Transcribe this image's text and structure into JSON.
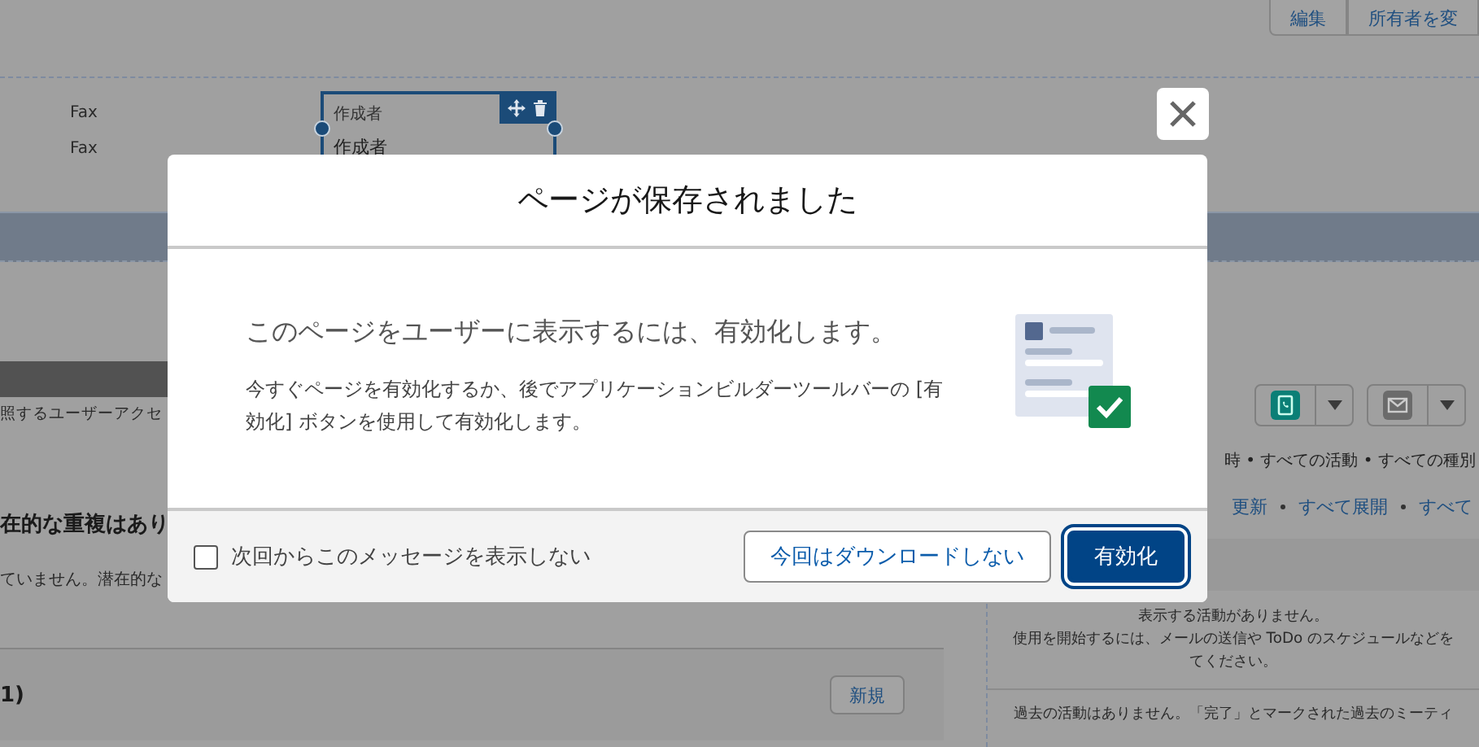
{
  "page": {
    "header_buttons": [
      "編集",
      "所有者を変"
    ],
    "fields": [
      "Fax",
      "Fax"
    ],
    "selected_component": {
      "labels": [
        "作成者",
        "作成者"
      ]
    },
    "left": {
      "access_text": "照するユーザーアクセ",
      "duplicates_title": "在的な重複はあり",
      "duplicates_text": "ていません。潜在的な",
      "related_title": "1)",
      "new_button": "新規"
    },
    "right": {
      "filter_text": "時 • すべての活動 • すべての種別",
      "links": [
        "更新",
        "すべて展開",
        "すべて"
      ],
      "upcoming_lines": [
        "表示する活動がありません。",
        "使用を開始するには、メールの送信や ToDo のスケジュールなどを",
        "てください。"
      ],
      "past_lines": [
        "過去の活動はありません。「完了」とマークされた過去のミーティ"
      ]
    }
  },
  "dialog": {
    "title": "ページが保存されました",
    "heading": "このページをユーザーに表示するには、有効化します。",
    "body": "今すぐページを有効化するか、後でアプリケーションビルダーツールバーの [有効化] ボタンを使用して有効化します。",
    "checkbox": {
      "label": "次回からこのメッセージを表示しない",
      "checked": false
    },
    "buttons": [
      {
        "label": "今回はダウンロードしない",
        "kind": "neutral"
      },
      {
        "label": "有効化",
        "kind": "brand"
      }
    ]
  }
}
